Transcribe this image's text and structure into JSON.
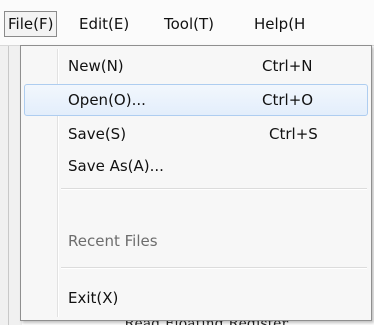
{
  "menubar": {
    "items": [
      {
        "label": "File(F)",
        "active": true
      },
      {
        "label": "Edit(E)",
        "active": false
      },
      {
        "label": "Tool(T)",
        "active": false
      },
      {
        "label": "Help(H",
        "active": false
      }
    ]
  },
  "file_menu": {
    "items": [
      {
        "label": "New(N)",
        "shortcut": "Ctrl+N"
      },
      {
        "label": "Open(O)...",
        "shortcut": "Ctrl+O",
        "highlighted": true
      },
      {
        "label": "Save(S)",
        "shortcut": "Ctrl+S"
      },
      {
        "label": "Save As(A)...",
        "shortcut": ""
      },
      {
        "label": "Recent Files",
        "shortcut": "",
        "disabled": true
      },
      {
        "label": "Exit(X)",
        "shortcut": ""
      }
    ]
  },
  "background": {
    "partial_text": "Read Floating Register"
  },
  "colors": {
    "highlight_border": "#aecdf0",
    "highlight_fill": "#e3eefb",
    "menu_bg": "#f7f7f7",
    "disabled_text": "#6d6d6d"
  }
}
